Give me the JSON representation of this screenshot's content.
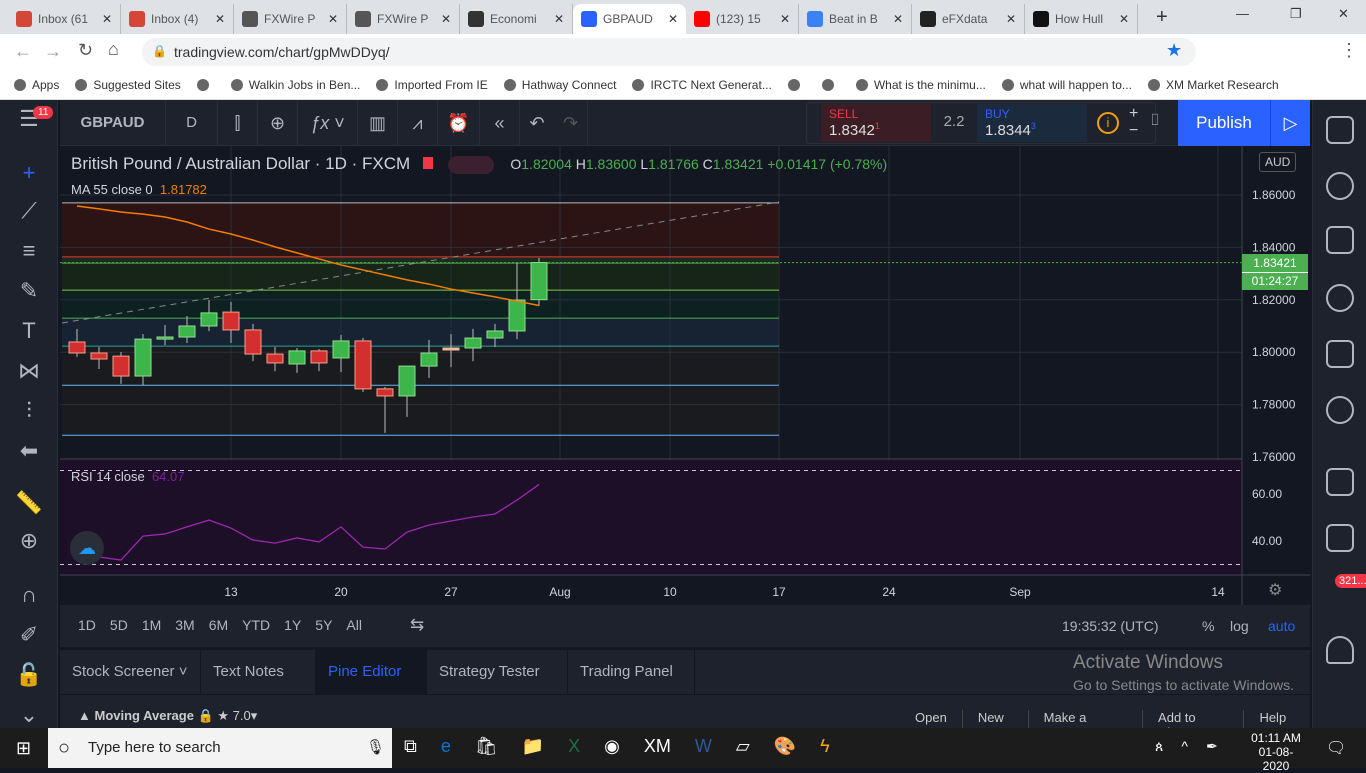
{
  "browser": {
    "tabs": [
      {
        "label": "Inbox (61",
        "icon": "gmail-icon",
        "color": "#d44638"
      },
      {
        "label": "Inbox (4)",
        "icon": "gmail-icon",
        "color": "#d44638"
      },
      {
        "label": "FXWire P",
        "icon": "globe-icon",
        "color": "#555"
      },
      {
        "label": "FXWire P",
        "icon": "globe-icon",
        "color": "#555"
      },
      {
        "label": "Economi",
        "icon": "investing-icon",
        "color": "#333"
      },
      {
        "label": "GBPAUD",
        "icon": "tradingview-icon",
        "color": "#2962ff"
      },
      {
        "label": "(123) 15",
        "icon": "youtube-icon",
        "color": "#f00"
      },
      {
        "label": "Beat in B",
        "icon": "app-icon",
        "color": "#3b82f6"
      },
      {
        "label": "eFXdata",
        "icon": "efx-icon",
        "color": "#222"
      },
      {
        "label": "How Hull",
        "icon": "app-icon",
        "color": "#111"
      }
    ],
    "url": "tradingview.com/chart/gpMwDDyq/",
    "bookmarks": [
      "Apps",
      "Suggested Sites",
      "",
      "Walkin Jobs in Ben...",
      "Imported From IE",
      "Hathway Connect",
      "IRCTC Next Generat...",
      "",
      "",
      "What is the minimu...",
      "what will happen to...",
      "XM Market Research"
    ]
  },
  "toolbar": {
    "symbol": "GBPAUD",
    "interval": "D",
    "sell_label": "SELL",
    "sell_price": "1.8342",
    "sell_sup": "1",
    "spread": "2.2",
    "buy_label": "BUY",
    "buy_price": "1.8344",
    "buy_sup": "3",
    "publish": "Publish"
  },
  "notif_badge": "11",
  "legend": {
    "title": "British Pound / Australian Dollar · 1D · FXCM",
    "o": "1.82004",
    "h": "1.83600",
    "l": "1.81766",
    "c": "1.83421",
    "change": "+0.01417 (+0.78%)",
    "ma_label": "MA 55 close 0",
    "ma_value": "1.81782",
    "rsi_label": "RSI 14 close",
    "rsi_value": "64.07",
    "currency": "AUD",
    "last_price": "1.83421",
    "countdown": "01:24:27"
  },
  "ranges": [
    "1D",
    "5D",
    "1M",
    "3M",
    "6M",
    "YTD",
    "1Y",
    "5Y",
    "All"
  ],
  "clock": "19:35:32 (UTC)",
  "scale_opts": [
    "%",
    "log",
    "auto"
  ],
  "panel": {
    "tabs": [
      "Stock Screener",
      "Text Notes",
      "Pine Editor",
      "Strategy Tester",
      "Trading Panel"
    ],
    "script_name": "Moving Average",
    "version": "7.0",
    "actions": [
      "Open",
      "New",
      "Make a Copy...",
      "Add to Chart",
      "Help"
    ],
    "watermark1": "Activate Windows",
    "watermark2": "Go to Settings to activate Windows."
  },
  "alerts_badge": "321...",
  "taskbar": {
    "search": "Type here to search",
    "time": "01:11 AM",
    "date": "01-08-2020"
  },
  "chart_data": {
    "type": "candlestick",
    "symbol": "GBPAUD",
    "ylim": [
      1.76,
      1.86
    ],
    "yticks": [
      "1.86000",
      "1.84000",
      "1.82000",
      "1.80000",
      "1.78000",
      "1.76000"
    ],
    "xticks": [
      "13",
      "20",
      "27",
      "Aug",
      "10",
      "17",
      "24",
      "Sep",
      "14"
    ],
    "candles": [
      [
        1.8039,
        1.8089,
        1.7982,
        1.7997
      ],
      [
        1.7997,
        1.802,
        1.7936,
        1.7974
      ],
      [
        1.7985,
        1.8001,
        1.7879,
        1.7909
      ],
      [
        1.7909,
        1.8069,
        1.7875,
        1.805
      ],
      [
        1.805,
        1.8104,
        1.8027,
        1.8058
      ],
      [
        1.8058,
        1.8138,
        1.8035,
        1.81
      ],
      [
        1.81,
        1.8199,
        1.8081,
        1.815
      ],
      [
        1.8153,
        1.8192,
        1.8035,
        1.8085
      ],
      [
        1.8085,
        1.8108,
        1.7966,
        1.7993
      ],
      [
        1.7993,
        1.802,
        1.7928,
        1.7959
      ],
      [
        1.7955,
        1.8016,
        1.7921,
        1.8005
      ],
      [
        1.8005,
        1.8012,
        1.7928,
        1.7959
      ],
      [
        1.7978,
        1.8066,
        1.7924,
        1.8043
      ],
      [
        1.8043,
        1.8054,
        1.7848,
        1.786
      ],
      [
        1.786,
        1.7867,
        1.7692,
        1.7833
      ],
      [
        1.7833,
        1.7947,
        1.7753,
        1.7947
      ],
      [
        1.7947,
        1.8047,
        1.7902,
        1.7997
      ],
      [
        1.8016,
        1.8069,
        1.7943,
        1.8016
      ],
      [
        1.8016,
        1.8089,
        1.7966,
        1.8054
      ],
      [
        1.8054,
        1.8108,
        1.802,
        1.8081
      ],
      [
        1.8081,
        1.834,
        1.805,
        1.8199
      ],
      [
        1.82004,
        1.836,
        1.81766,
        1.83421
      ]
    ],
    "ma55": [
      1.8558,
      1.8547,
      1.8535,
      1.8527,
      1.8516,
      1.8497,
      1.847,
      1.8451,
      1.8428,
      1.8402,
      1.8379,
      1.8356,
      1.8333,
      1.8314,
      1.8295,
      1.8276,
      1.826,
      1.8241,
      1.8226,
      1.8211,
      1.8195,
      1.81782
    ],
    "rsi": [
      37.0,
      33.2,
      31.9,
      42.1,
      43.0,
      46.0,
      48.9,
      45.5,
      40.4,
      39.1,
      41.3,
      39.6,
      46.0,
      37.4,
      36.6,
      43.8,
      46.8,
      48.5,
      50.2,
      51.5,
      57.4,
      64.07
    ],
    "rsi_ticks": [
      "60.00",
      "40.00"
    ],
    "fib_levels": [
      1.857,
      1.8364,
      1.834,
      1.8237,
      1.813,
      1.8023,
      1.7874,
      1.7683
    ]
  }
}
